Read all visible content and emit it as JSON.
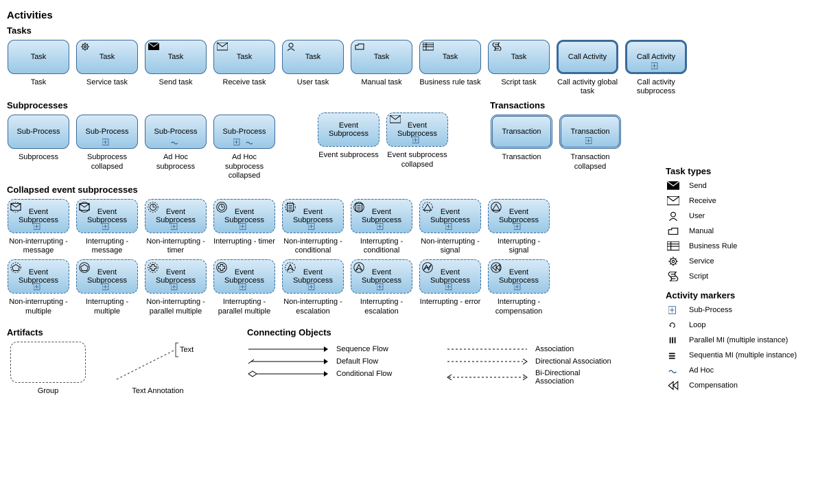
{
  "headings": {
    "activities": "Activities",
    "tasks": "Tasks",
    "subprocesses": "Subprocesses",
    "transactions": "Transactions",
    "collapsed": "Collapsed event subprocesses",
    "artifacts": "Artifacts",
    "connecting": "Connecting Objects",
    "task_types": "Task types",
    "activity_markers": "Activity markers"
  },
  "tasks": [
    {
      "label": "Task",
      "caption": "Task",
      "icon": null
    },
    {
      "label": "Task",
      "caption": "Service task",
      "icon": "gear"
    },
    {
      "label": "Task",
      "caption": "Send task",
      "icon": "send"
    },
    {
      "label": "Task",
      "caption": "Receive task",
      "icon": "receive"
    },
    {
      "label": "Task",
      "caption": "User task",
      "icon": "user"
    },
    {
      "label": "Task",
      "caption": "Manual task",
      "icon": "manual"
    },
    {
      "label": "Task",
      "caption": "Business rule task",
      "icon": "rule"
    },
    {
      "label": "Task",
      "caption": "Script task",
      "icon": "script"
    },
    {
      "label": "Call Activity",
      "caption": "Call activity global task",
      "icon": null,
      "thick": true
    },
    {
      "label": "Call Activity",
      "caption": "Call activity subprocess",
      "icon": null,
      "thick": true,
      "marker": "plus"
    }
  ],
  "subprocesses": [
    {
      "label": "Sub-Process",
      "caption": "Subprocess"
    },
    {
      "label": "Sub-Process",
      "caption": "Subprocess collapsed",
      "marker": "plus"
    },
    {
      "label": "Sub-Process",
      "caption": "Ad Hoc subprocess",
      "marker": "tilde"
    },
    {
      "label": "Sub-Process",
      "caption": "Ad Hoc subprocess collapsed",
      "marker": "plustilde"
    }
  ],
  "event_sub": [
    {
      "label": "Event Subprocess",
      "caption": "Event subprocess",
      "dashed": true
    },
    {
      "label": "Event Subprocess",
      "caption": "Event subprocess collapsed",
      "dashed": true,
      "icon": "receive",
      "marker": "plus"
    }
  ],
  "transactions": [
    {
      "label": "Transaction",
      "caption": "Transaction",
      "double": true
    },
    {
      "label": "Transaction",
      "caption": "Transaction collapsed",
      "double": true,
      "marker": "plus"
    }
  ],
  "collapsed_rows": [
    [
      {
        "caption": "Non-interrupting - message",
        "icon": "receive",
        "dashedIcon": true
      },
      {
        "caption": "Interrupting - message",
        "icon": "receive"
      },
      {
        "caption": "Non-interrupting - timer",
        "icon": "timer",
        "dashedIcon": true
      },
      {
        "caption": "Interrupting - timer",
        "icon": "timer"
      },
      {
        "caption": "Non-interrupting - conditional",
        "icon": "cond",
        "dashedIcon": true
      },
      {
        "caption": "Interrupting - conditional",
        "icon": "cond"
      },
      {
        "caption": "Non-interrupting - signal",
        "icon": "signal",
        "dashedIcon": true
      },
      {
        "caption": "Interrupting - signal",
        "icon": "signal"
      }
    ],
    [
      {
        "caption": "Non-interrupting - multiple",
        "icon": "multi",
        "dashedIcon": true
      },
      {
        "caption": "Interrupting - multiple",
        "icon": "multi"
      },
      {
        "caption": "Non-interrupting - parallel multiple",
        "icon": "pmulti",
        "dashedIcon": true
      },
      {
        "caption": "Interrupting - parallel multiple",
        "icon": "pmulti"
      },
      {
        "caption": "Non-interrupting - escalation",
        "icon": "esc",
        "dashedIcon": true
      },
      {
        "caption": "Interrupting - escalation",
        "icon": "esc"
      },
      {
        "caption": "Interrupting - error",
        "icon": "error"
      },
      {
        "caption": "Interrupting - compensation",
        "icon": "comp"
      }
    ]
  ],
  "collapsed_label": "Event Subprocess",
  "artifacts": {
    "group": "Group",
    "text": "Text",
    "text_annotation": "Text Annotation"
  },
  "connectors": [
    {
      "name": "Sequence Flow",
      "type": "seq"
    },
    {
      "name": "Default Flow",
      "type": "def"
    },
    {
      "name": "Conditional Flow",
      "type": "cond"
    },
    {
      "name": "Association",
      "type": "assoc"
    },
    {
      "name": "Directional Association",
      "type": "dassoc"
    },
    {
      "name": "Bi-Directional Association",
      "type": "bidir"
    }
  ],
  "task_types_legend": [
    {
      "icon": "send",
      "label": "Send"
    },
    {
      "icon": "receive",
      "label": "Receive"
    },
    {
      "icon": "user",
      "label": "User"
    },
    {
      "icon": "manual",
      "label": "Manual"
    },
    {
      "icon": "rule",
      "label": "Business Rule"
    },
    {
      "icon": "gear",
      "label": "Service"
    },
    {
      "icon": "script",
      "label": "Script"
    }
  ],
  "activity_markers_legend": [
    {
      "icon": "plus",
      "label": "Sub-Process"
    },
    {
      "icon": "loop",
      "label": "Loop"
    },
    {
      "icon": "pmi",
      "label": "Parallel MI (multiple instance)"
    },
    {
      "icon": "smi",
      "label": "Sequentia MI (multiple instance)"
    },
    {
      "icon": "tilde",
      "label": "Ad Hoc"
    },
    {
      "icon": "comp",
      "label": "Compensation"
    }
  ]
}
